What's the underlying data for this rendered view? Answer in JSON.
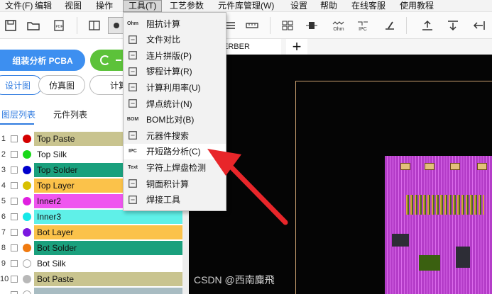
{
  "menubar": {
    "items": [
      "文件(F)",
      "编辑",
      "视图",
      "操作",
      "工具(T)",
      "工艺参数",
      "元件库管理(W)",
      "设置",
      "帮助",
      "在线客服",
      "使用教程"
    ],
    "active_index": 4
  },
  "toolbar": {
    "icons": [
      "save-icon",
      "open-folder-icon",
      "pdf-icon",
      "layout-icon",
      "view-icon",
      "align-icon",
      "ruler-icon",
      "panel-icon",
      "resistor-icon",
      "ohm-icon",
      "ipc-icon",
      "solder-iron-icon",
      "export-up-icon",
      "download-icon",
      "arrow-left-icon"
    ],
    "ohm_text": "Ohm",
    "ipc_text": "IPC"
  },
  "tabstrip": {
    "gerber_tab": "ERBER",
    "plus": "+"
  },
  "left": {
    "pcba_button": "组装分析 PCBA",
    "mode_tabs": [
      "设计图",
      "仿真图",
      "计算"
    ],
    "list_tabs": [
      "图层列表",
      "元件列表"
    ]
  },
  "layers": [
    {
      "num": "1",
      "label": "Top Paste",
      "dot": "#d40000",
      "bg": "#c9c48f"
    },
    {
      "num": "2",
      "label": "Top Silk",
      "dot": "#18d818",
      "bg": "#ffffff"
    },
    {
      "num": "3",
      "label": "Top Solder",
      "dot": "#0000cc",
      "bg": "#1aa07d"
    },
    {
      "num": "4",
      "label": "Top Layer",
      "dot": "#d8c000",
      "bg": "#fbc24a"
    },
    {
      "num": "5",
      "label": "Inner2",
      "dot": "#e020e0",
      "bg": "#ef55ef"
    },
    {
      "num": "6",
      "label": "Inner3",
      "dot": "#16e8e8",
      "bg": "#5ff0e8"
    },
    {
      "num": "7",
      "label": "Bot Layer",
      "dot": "#7a18e0",
      "bg": "#fbc24a"
    },
    {
      "num": "8",
      "label": "Bot Solder",
      "dot": "#f07a10",
      "bg": "#1aa07d"
    },
    {
      "num": "9",
      "label": "Bot Silk",
      "dot": "#ffffff",
      "bg": "#ffffff"
    },
    {
      "num": "10",
      "label": "Bot Paste",
      "dot": "#b8b8b8",
      "bg": "#c9c48f"
    },
    {
      "num": "",
      "label": "",
      "dot": "#ffffff",
      "bg": "#a8bcc2"
    }
  ],
  "dropdown": {
    "items": [
      {
        "icon": "ohm-icon",
        "icon_text": "Ohm",
        "label": "阻抗计算"
      },
      {
        "icon": "file-compare-icon",
        "icon_text": "",
        "label": "文件对比"
      },
      {
        "icon": "panelize-icon",
        "icon_text": "",
        "label": "连片拼版(P)"
      },
      {
        "icon": "stencil-icon",
        "icon_text": "",
        "label": "锣程计算(R)"
      },
      {
        "icon": "utilization-icon",
        "icon_text": "",
        "label": "计算利用率(U)"
      },
      {
        "icon": "solder-joint-icon",
        "icon_text": "",
        "label": "焊点统计(N)"
      },
      {
        "icon": "bom-icon",
        "icon_text": "BOM",
        "label": "BOM比对(B)"
      },
      {
        "icon": "component-search-icon",
        "icon_text": "",
        "label": "元器件搜索"
      },
      {
        "icon": "ipc-icon",
        "icon_text": "IPC",
        "label": "开短路分析(C)"
      },
      {
        "icon": "text-pad-icon",
        "icon_text": "Text",
        "label": "字符上焊盘检测"
      },
      {
        "icon": "copper-area-icon",
        "icon_text": "",
        "label": "铜面积计算"
      },
      {
        "icon": "solder-tool-icon",
        "icon_text": "",
        "label": "焊接工具"
      }
    ],
    "highlight_index": 8
  },
  "watermark": "CSDN @西南麋飛",
  "colors": {
    "accent_blue": "#3d8ff0",
    "accent_green": "#5cc23a",
    "arrow_red": "#e8262a",
    "canvas_bg": "#050505",
    "pcb_magenta": "#b43cc8"
  }
}
